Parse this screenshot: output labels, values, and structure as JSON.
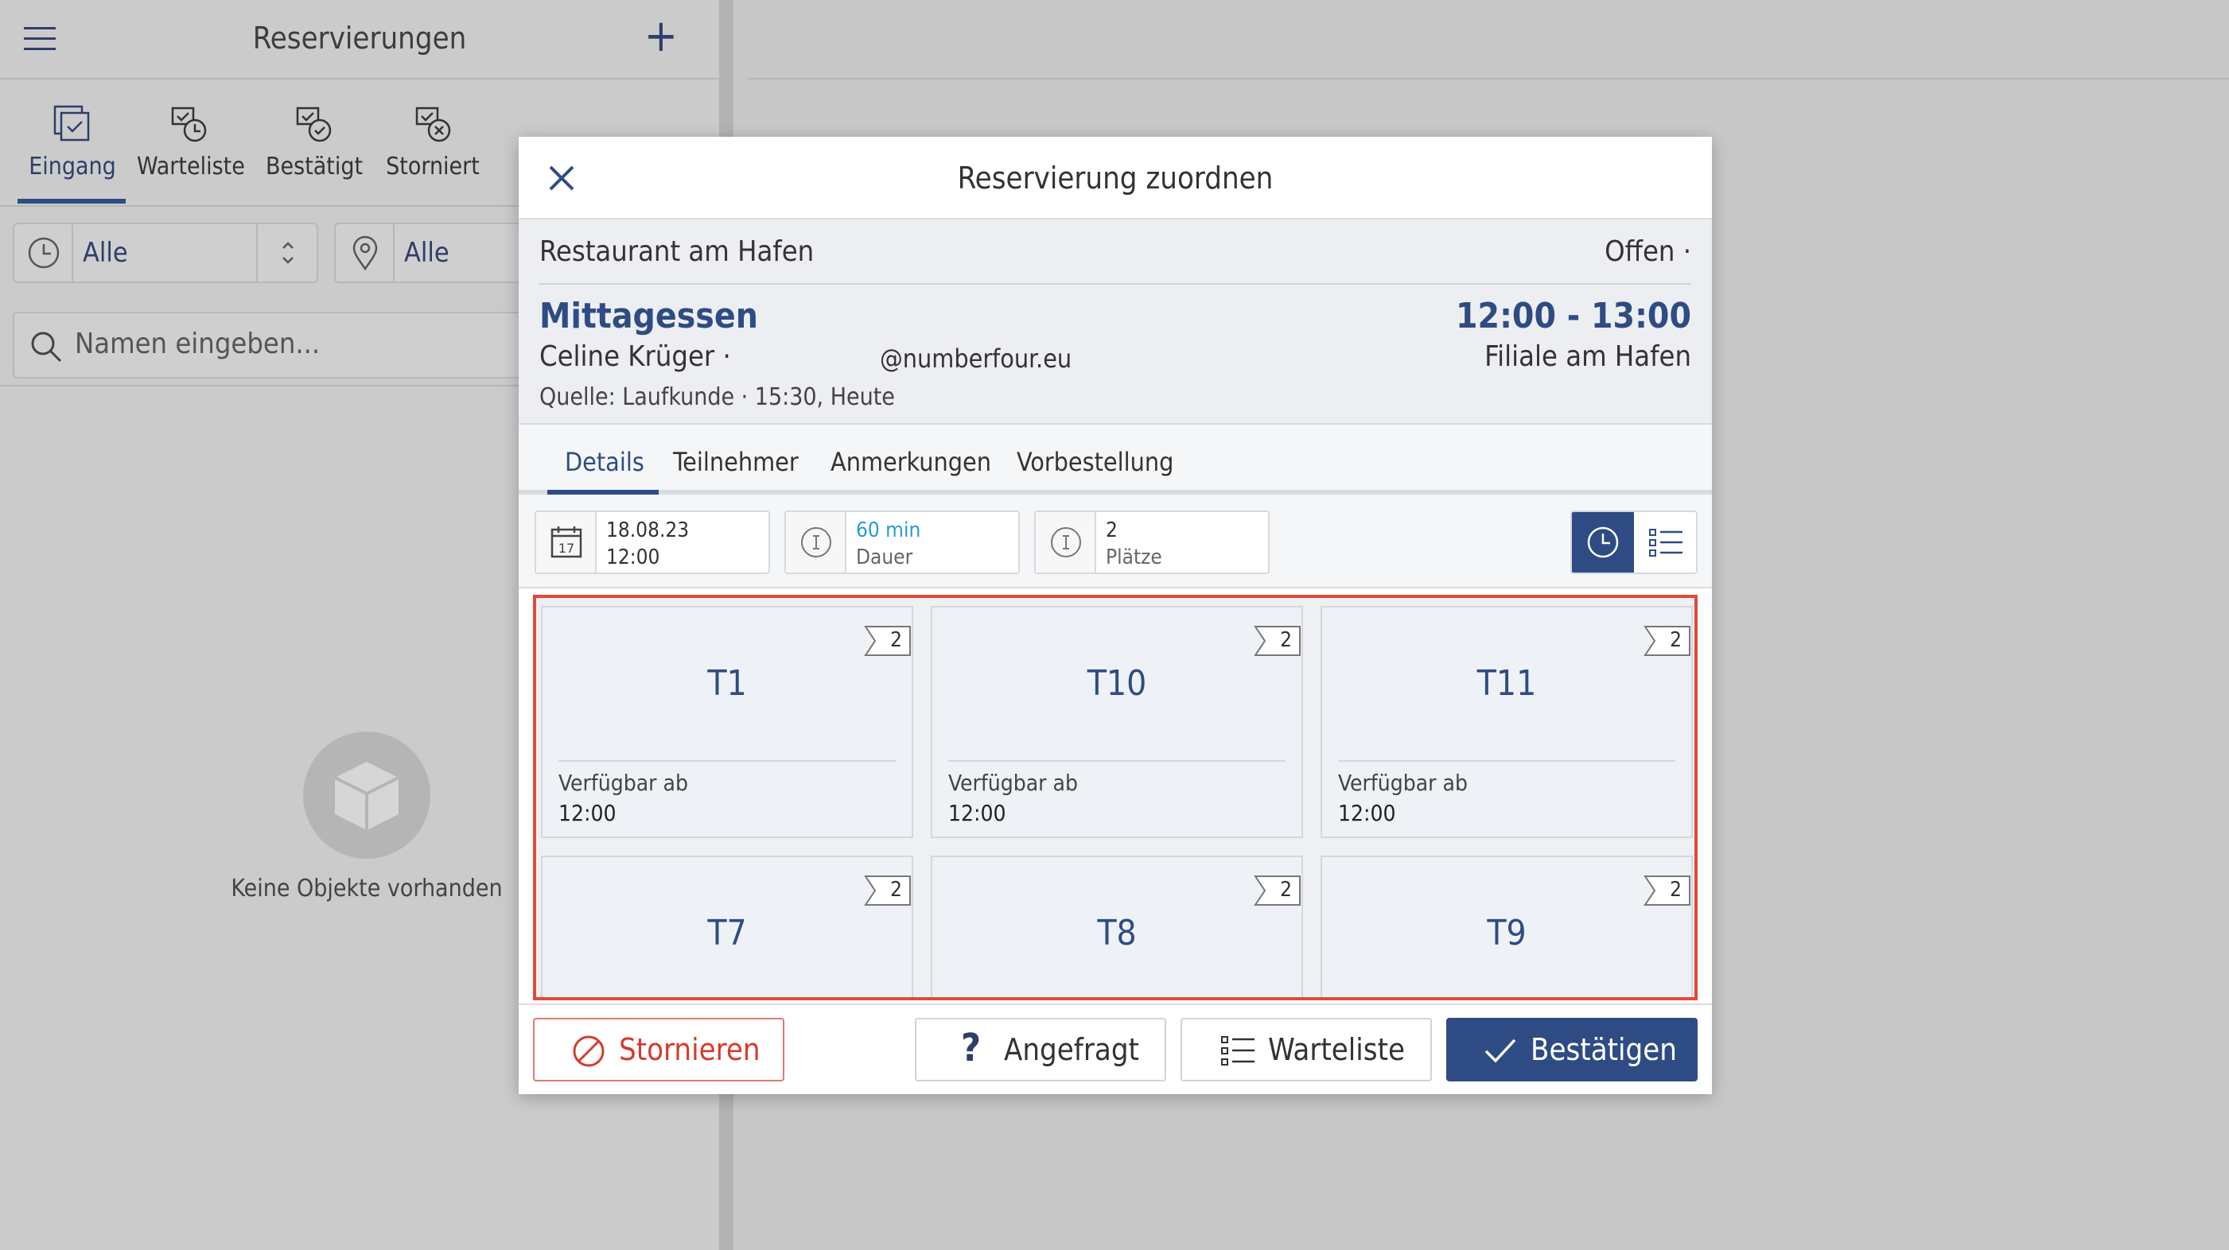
{
  "left_panel": {
    "title": "Reservierungen",
    "plus": "+",
    "tabs": [
      {
        "label": "Eingang",
        "active": true
      },
      {
        "label": "Warteliste"
      },
      {
        "label": "Bestätigt"
      },
      {
        "label": "Storniert"
      }
    ],
    "filter_time": "Alle",
    "filter_location": "Alle",
    "search_placeholder": "Namen eingeben...",
    "empty_text": "Keine Objekte vorhanden"
  },
  "modal": {
    "title": "Reservierung zuordnen",
    "restaurant": "Restaurant am Hafen",
    "status": "Offen ·",
    "event": "Mittagessen",
    "time_range": "12:00 - 13:00",
    "guest": "Celine Krüger ·",
    "email": "@numberfour.eu",
    "branch": "Filiale am Hafen",
    "source": "Quelle: Laufkunde · 15:30, Heute",
    "tabs": [
      "Details",
      "Teilnehmer",
      "Anmerkungen",
      "Vorbestellung"
    ],
    "fields": {
      "date": "18.08.23",
      "time": "12:00",
      "duration_value": "60 min",
      "duration_label": "Dauer",
      "seats_value": "2",
      "seats_label": "Plätze"
    },
    "tables": [
      {
        "name": "T1",
        "capacity": "2",
        "avail_label": "Verfügbar ab",
        "avail_time": "12:00"
      },
      {
        "name": "T10",
        "capacity": "2",
        "avail_label": "Verfügbar ab",
        "avail_time": "12:00"
      },
      {
        "name": "T11",
        "capacity": "2",
        "avail_label": "Verfügbar ab",
        "avail_time": "12:00"
      },
      {
        "name": "T7",
        "capacity": "2"
      },
      {
        "name": "T8",
        "capacity": "2"
      },
      {
        "name": "T9",
        "capacity": "2"
      }
    ],
    "buttons": {
      "cancel": "Stornieren",
      "requested": "Angefragt",
      "waitlist": "Warteliste",
      "confirm": "Bestätigen"
    }
  },
  "colors": {
    "primary": "#2e4c83",
    "danger": "#d43c2f",
    "highlight": "#e04a3a",
    "info": "#2a9ad6"
  }
}
